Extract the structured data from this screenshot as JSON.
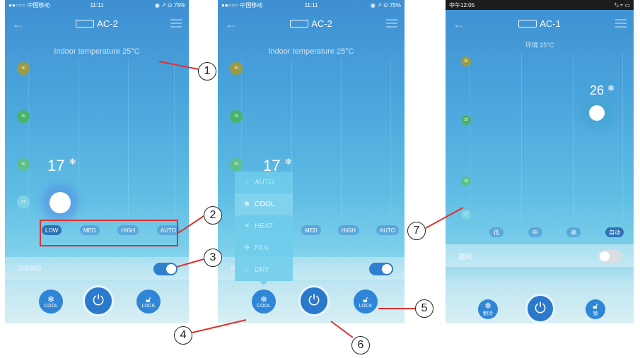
{
  "screen1": {
    "status": {
      "carrier": "●●○○○ 中国移动 ",
      "time": "11:11",
      "right": "◉ ↗ ⊙ 75%"
    },
    "title": "AC-2",
    "indoor": "Indoor temperature 25°C",
    "scale": [
      "30",
      "25",
      "20",
      "17"
    ],
    "setpoint": "17",
    "fan_speeds": [
      "LOW",
      "MED",
      "HIGH",
      "AUTO"
    ],
    "selected_speed": "LOW",
    "swing_label": "SWING",
    "swing_on": true,
    "buttons": {
      "mode": "COOL",
      "lock": "LOCK"
    }
  },
  "screen2": {
    "status": {
      "carrier": "●●○○○ 中国移动 ",
      "time": "11:11",
      "right": "◉ ↗ ⊙ 75%"
    },
    "title": "AC-2",
    "indoor": "Indoor temperature 25°C",
    "scale": [
      "30",
      "25",
      "20"
    ],
    "setpoint": "17",
    "fan_speeds": [
      "MED",
      "HIGH",
      "AUTO"
    ],
    "swing_label": "S",
    "mode_menu": [
      "AUTO",
      "COOL",
      "HEAT",
      "FAN",
      "DRY"
    ],
    "selected_mode": "COOL",
    "buttons": {
      "mode": "COOL",
      "lock": "LOCK"
    }
  },
  "screen3": {
    "status": {
      "time": "中午12:05",
      "right": "ᵀᵢₗ ≈ ▭"
    },
    "title": "AC-1",
    "indoor": "环境 25°C",
    "scale": [
      "30",
      "25",
      "20",
      "17"
    ],
    "setpoint": "26",
    "fan_speeds": [
      "低",
      "中",
      "高",
      "自动"
    ],
    "selected_speed": "自动",
    "swing_label": "摆风",
    "swing_on": false,
    "buttons": {
      "mode": "制冷",
      "lock": "锁"
    }
  },
  "callouts": [
    "1",
    "2",
    "3",
    "4",
    "5",
    "6",
    "7"
  ],
  "colors": {
    "callout_line": "#e03030",
    "toggle_on": "#2f7fd0",
    "button": "#2f86d6"
  }
}
